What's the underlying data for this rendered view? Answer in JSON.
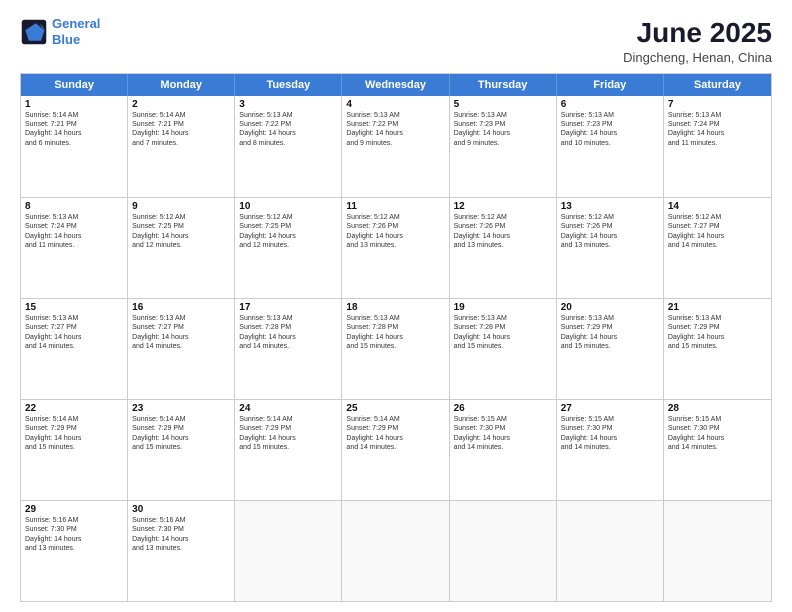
{
  "header": {
    "logo_line1": "General",
    "logo_line2": "Blue",
    "month_year": "June 2025",
    "location": "Dingcheng, Henan, China"
  },
  "days_of_week": [
    "Sunday",
    "Monday",
    "Tuesday",
    "Wednesday",
    "Thursday",
    "Friday",
    "Saturday"
  ],
  "weeks": [
    [
      {
        "day": "1",
        "info": "Sunrise: 5:14 AM\nSunset: 7:21 PM\nDaylight: 14 hours\nand 6 minutes."
      },
      {
        "day": "2",
        "info": "Sunrise: 5:14 AM\nSunset: 7:21 PM\nDaylight: 14 hours\nand 7 minutes."
      },
      {
        "day": "3",
        "info": "Sunrise: 5:13 AM\nSunset: 7:22 PM\nDaylight: 14 hours\nand 8 minutes."
      },
      {
        "day": "4",
        "info": "Sunrise: 5:13 AM\nSunset: 7:22 PM\nDaylight: 14 hours\nand 9 minutes."
      },
      {
        "day": "5",
        "info": "Sunrise: 5:13 AM\nSunset: 7:23 PM\nDaylight: 14 hours\nand 9 minutes."
      },
      {
        "day": "6",
        "info": "Sunrise: 5:13 AM\nSunset: 7:23 PM\nDaylight: 14 hours\nand 10 minutes."
      },
      {
        "day": "7",
        "info": "Sunrise: 5:13 AM\nSunset: 7:24 PM\nDaylight: 14 hours\nand 11 minutes."
      }
    ],
    [
      {
        "day": "8",
        "info": "Sunrise: 5:13 AM\nSunset: 7:24 PM\nDaylight: 14 hours\nand 11 minutes."
      },
      {
        "day": "9",
        "info": "Sunrise: 5:12 AM\nSunset: 7:25 PM\nDaylight: 14 hours\nand 12 minutes."
      },
      {
        "day": "10",
        "info": "Sunrise: 5:12 AM\nSunset: 7:25 PM\nDaylight: 14 hours\nand 12 minutes."
      },
      {
        "day": "11",
        "info": "Sunrise: 5:12 AM\nSunset: 7:26 PM\nDaylight: 14 hours\nand 13 minutes."
      },
      {
        "day": "12",
        "info": "Sunrise: 5:12 AM\nSunset: 7:26 PM\nDaylight: 14 hours\nand 13 minutes."
      },
      {
        "day": "13",
        "info": "Sunrise: 5:12 AM\nSunset: 7:26 PM\nDaylight: 14 hours\nand 13 minutes."
      },
      {
        "day": "14",
        "info": "Sunrise: 5:12 AM\nSunset: 7:27 PM\nDaylight: 14 hours\nand 14 minutes."
      }
    ],
    [
      {
        "day": "15",
        "info": "Sunrise: 5:13 AM\nSunset: 7:27 PM\nDaylight: 14 hours\nand 14 minutes."
      },
      {
        "day": "16",
        "info": "Sunrise: 5:13 AM\nSunset: 7:27 PM\nDaylight: 14 hours\nand 14 minutes."
      },
      {
        "day": "17",
        "info": "Sunrise: 5:13 AM\nSunset: 7:28 PM\nDaylight: 14 hours\nand 14 minutes."
      },
      {
        "day": "18",
        "info": "Sunrise: 5:13 AM\nSunset: 7:28 PM\nDaylight: 14 hours\nand 15 minutes."
      },
      {
        "day": "19",
        "info": "Sunrise: 5:13 AM\nSunset: 7:28 PM\nDaylight: 14 hours\nand 15 minutes."
      },
      {
        "day": "20",
        "info": "Sunrise: 5:13 AM\nSunset: 7:29 PM\nDaylight: 14 hours\nand 15 minutes."
      },
      {
        "day": "21",
        "info": "Sunrise: 5:13 AM\nSunset: 7:29 PM\nDaylight: 14 hours\nand 15 minutes."
      }
    ],
    [
      {
        "day": "22",
        "info": "Sunrise: 5:14 AM\nSunset: 7:29 PM\nDaylight: 14 hours\nand 15 minutes."
      },
      {
        "day": "23",
        "info": "Sunrise: 5:14 AM\nSunset: 7:29 PM\nDaylight: 14 hours\nand 15 minutes."
      },
      {
        "day": "24",
        "info": "Sunrise: 5:14 AM\nSunset: 7:29 PM\nDaylight: 14 hours\nand 15 minutes."
      },
      {
        "day": "25",
        "info": "Sunrise: 5:14 AM\nSunset: 7:29 PM\nDaylight: 14 hours\nand 14 minutes."
      },
      {
        "day": "26",
        "info": "Sunrise: 5:15 AM\nSunset: 7:30 PM\nDaylight: 14 hours\nand 14 minutes."
      },
      {
        "day": "27",
        "info": "Sunrise: 5:15 AM\nSunset: 7:30 PM\nDaylight: 14 hours\nand 14 minutes."
      },
      {
        "day": "28",
        "info": "Sunrise: 5:15 AM\nSunset: 7:30 PM\nDaylight: 14 hours\nand 14 minutes."
      }
    ],
    [
      {
        "day": "29",
        "info": "Sunrise: 5:16 AM\nSunset: 7:30 PM\nDaylight: 14 hours\nand 13 minutes."
      },
      {
        "day": "30",
        "info": "Sunrise: 5:16 AM\nSunset: 7:30 PM\nDaylight: 14 hours\nand 13 minutes."
      },
      {
        "day": "",
        "info": ""
      },
      {
        "day": "",
        "info": ""
      },
      {
        "day": "",
        "info": ""
      },
      {
        "day": "",
        "info": ""
      },
      {
        "day": "",
        "info": ""
      }
    ]
  ]
}
